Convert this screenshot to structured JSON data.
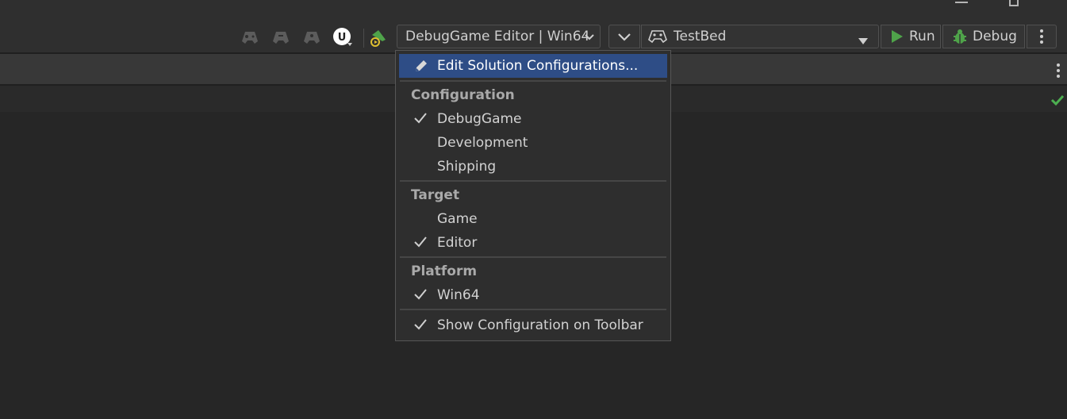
{
  "toolbar": {
    "config_combo_value": "DebugGame Editor | Win64",
    "run_target_value": "TestBed",
    "run_label": "Run",
    "debug_label": "Debug"
  },
  "menu": {
    "edit_item": "Edit Solution Configurations...",
    "configuration_header": "Configuration",
    "configurations": [
      {
        "label": "DebugGame",
        "checked": true
      },
      {
        "label": "Development",
        "checked": false
      },
      {
        "label": "Shipping",
        "checked": false
      }
    ],
    "target_header": "Target",
    "targets": [
      {
        "label": "Game",
        "checked": false
      },
      {
        "label": "Editor",
        "checked": true
      }
    ],
    "platform_header": "Platform",
    "platforms": [
      {
        "label": "Win64",
        "checked": true
      }
    ],
    "show_config_item": {
      "label": "Show Configuration on Toolbar",
      "checked": true
    }
  },
  "colors": {
    "accent_highlight": "#2e4d86",
    "run_green": "#4fa34a",
    "status_green": "#4caf50"
  },
  "icons": [
    "gamepad-icon",
    "ue-logo-icon",
    "build-icon",
    "chevron-down-icon",
    "run-icon",
    "bug-icon",
    "more-vertical-icon",
    "pencil-icon",
    "check-icon"
  ]
}
